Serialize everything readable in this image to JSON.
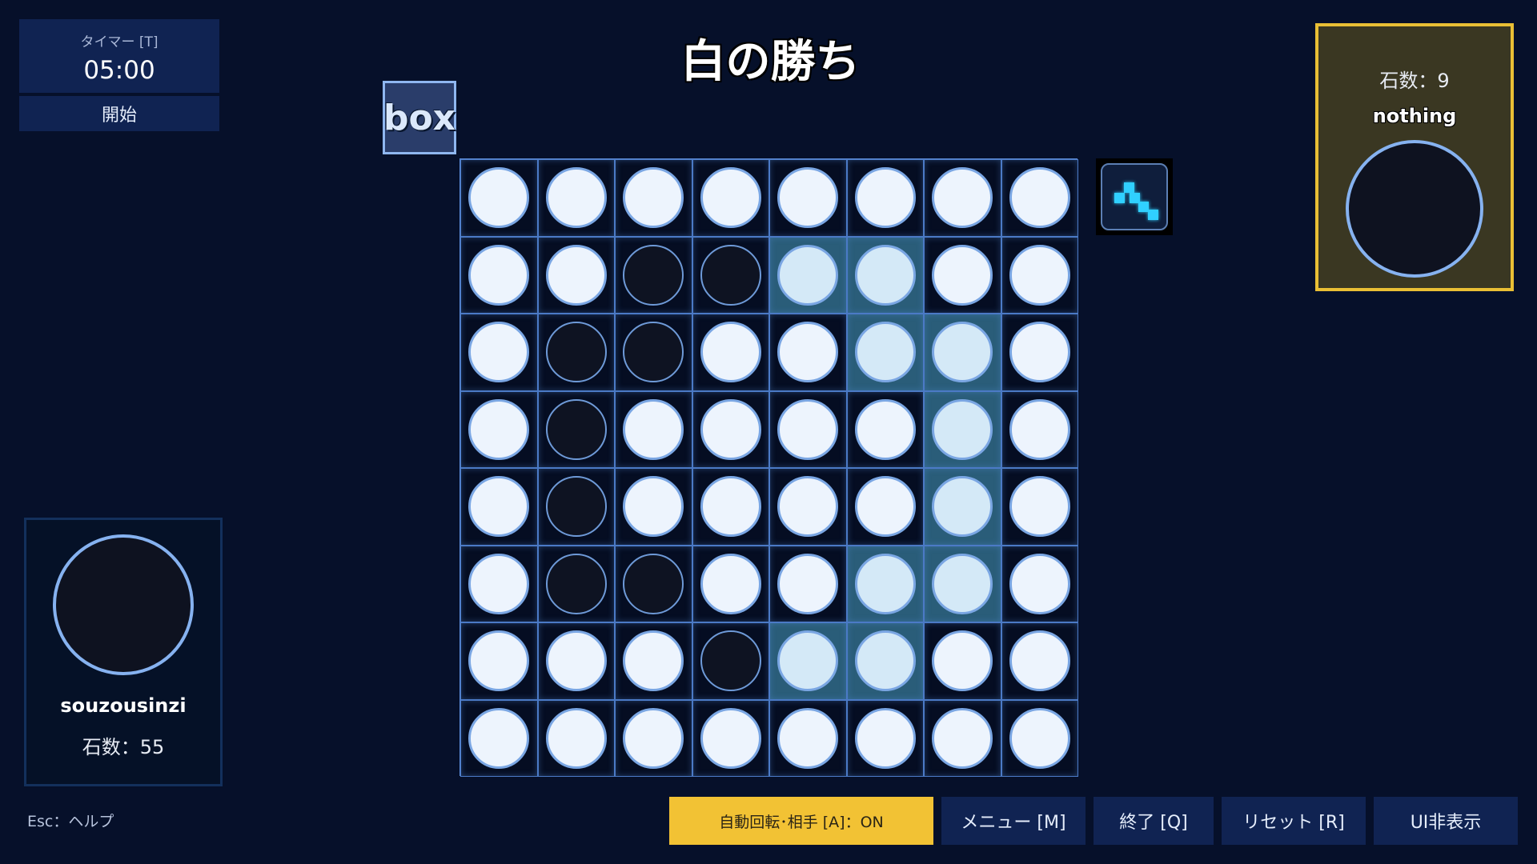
{
  "timer": {
    "label": "タイマー [T]",
    "value": "05:00",
    "start_label": "開始"
  },
  "result_title": "白の勝ち",
  "box_button_label": "box",
  "board": {
    "size": 8,
    "rows": [
      [
        "W",
        "W",
        "W",
        "W",
        "W",
        "W",
        "W",
        "W"
      ],
      [
        "W",
        "W",
        "B",
        "B",
        "W",
        "W",
        "W",
        "W"
      ],
      [
        "W",
        "B",
        "B",
        "W",
        "W",
        "W",
        "W",
        "W"
      ],
      [
        "W",
        "B",
        "W",
        "W",
        "W",
        "W",
        "W",
        "W"
      ],
      [
        "W",
        "B",
        "W",
        "W",
        "W",
        "W",
        "W",
        "W"
      ],
      [
        "W",
        "B",
        "B",
        "W",
        "W",
        "W",
        "W",
        "W"
      ],
      [
        "W",
        "W",
        "W",
        "B",
        "W",
        "W",
        "W",
        "W"
      ],
      [
        "W",
        "W",
        "W",
        "W",
        "W",
        "W",
        "W",
        "W"
      ]
    ],
    "highlighted_cells": [
      [
        1,
        4
      ],
      [
        1,
        5
      ],
      [
        2,
        5
      ],
      [
        2,
        6
      ],
      [
        3,
        6
      ],
      [
        4,
        6
      ],
      [
        5,
        5
      ],
      [
        5,
        6
      ],
      [
        6,
        4
      ],
      [
        6,
        5
      ]
    ]
  },
  "opponent": {
    "count_label": "石数：9",
    "name": "nothing",
    "color": "black"
  },
  "player": {
    "name": "souzousinzi",
    "count_label": "石数：55",
    "color": "black"
  },
  "help_hint": "Esc：ヘルプ",
  "buttons": {
    "auto_rotate": "自動回転･相手 [A]：ON",
    "menu": "メニュー [M]",
    "quit": "終了 [Q]",
    "reset": "リセット [R]",
    "hide_ui": "UI非表示"
  },
  "colors": {
    "background": "#06102a",
    "panel": "#102352",
    "accent_yellow": "#f2c234",
    "highlight_cell": "#2a5d79",
    "grid_line": "#4b7ac6"
  }
}
